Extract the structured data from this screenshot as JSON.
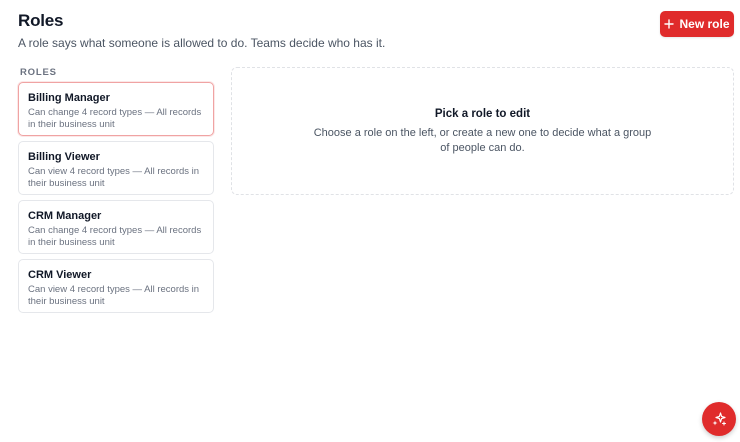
{
  "header": {
    "title": "Roles",
    "subtitle": "A role says what someone is allowed to do. Teams decide who has it.",
    "new_role_label": "New role"
  },
  "sidebar": {
    "heading": "ROLES",
    "items": [
      {
        "name": "Billing Manager",
        "description": "Can change 4 record types — All records in their business unit",
        "selected": true
      },
      {
        "name": "Billing Viewer",
        "description": "Can view 4 record types — All records in their business unit",
        "selected": false
      },
      {
        "name": "CRM Manager",
        "description": "Can change 4 record types — All records in their business unit",
        "selected": false
      },
      {
        "name": "CRM Viewer",
        "description": "Can view 4 record types — All records in their business unit",
        "selected": false
      }
    ]
  },
  "editor": {
    "empty_title": "Pick a role to edit",
    "empty_description": "Choose a role on the left, or create a new one to decide what a group of people can do."
  },
  "icons": {
    "new_role": "plus-icon",
    "assistant": "sparkles-icon"
  },
  "colors": {
    "accent": "#e02b2b",
    "selected_border": "#f0a3a3"
  }
}
